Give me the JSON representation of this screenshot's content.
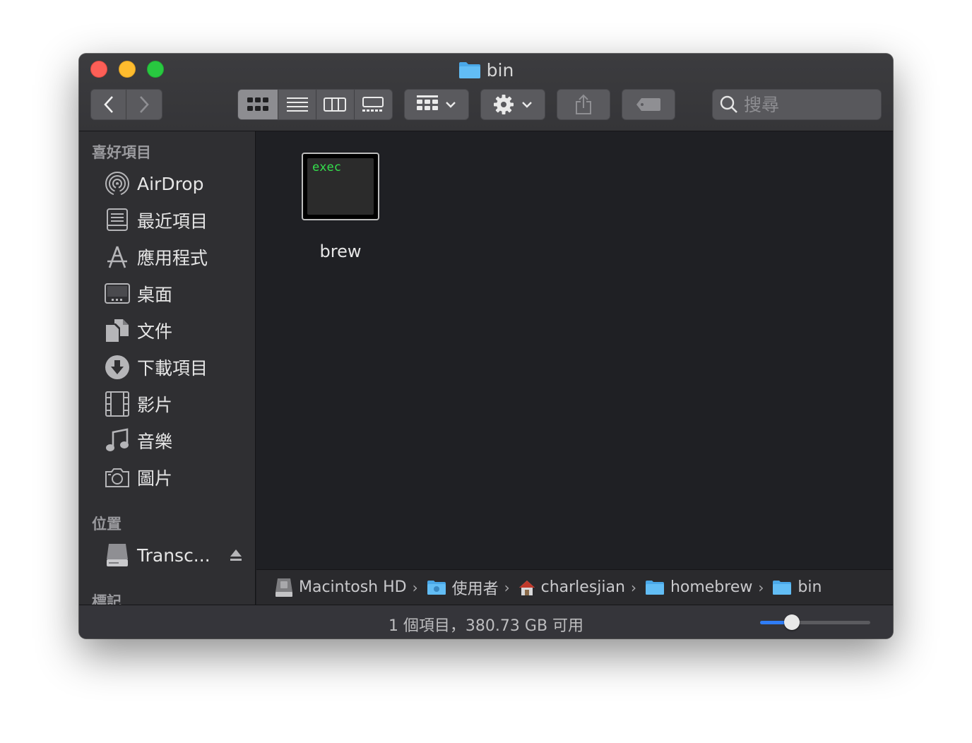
{
  "window": {
    "title": "bin"
  },
  "toolbar": {
    "back": "back",
    "forward": "forward",
    "view_modes": [
      "icon-view",
      "list-view",
      "column-view",
      "gallery-view"
    ],
    "group_by": "group-by",
    "action": "action",
    "share": "share",
    "tags": "tags"
  },
  "search": {
    "placeholder": "搜尋"
  },
  "sidebar": {
    "favorites_heading": "喜好項目",
    "favorites": [
      {
        "label": "AirDrop",
        "icon": "airdrop-icon"
      },
      {
        "label": "最近項目",
        "icon": "recents-icon"
      },
      {
        "label": "應用程式",
        "icon": "applications-icon"
      },
      {
        "label": "桌面",
        "icon": "desktop-icon"
      },
      {
        "label": "文件",
        "icon": "documents-icon"
      },
      {
        "label": "下載項目",
        "icon": "downloads-icon"
      },
      {
        "label": "影片",
        "icon": "movies-icon"
      },
      {
        "label": "音樂",
        "icon": "music-icon"
      },
      {
        "label": "圖片",
        "icon": "pictures-icon"
      }
    ],
    "locations_heading": "位置",
    "locations": [
      {
        "label": "Transc...",
        "icon": "drive-icon"
      }
    ],
    "tags_heading": "標記"
  },
  "files": [
    {
      "name": "brew",
      "icon_text": "exec"
    }
  ],
  "path": [
    {
      "label": "Macintosh HD",
      "icon": "hard-drive-icon"
    },
    {
      "label": "使用者",
      "icon": "users-folder-icon"
    },
    {
      "label": "charlesjian",
      "icon": "home-icon"
    },
    {
      "label": "homebrew",
      "icon": "folder-icon"
    },
    {
      "label": "bin",
      "icon": "folder-icon"
    }
  ],
  "status": {
    "text": "1 個項目，380.73 GB 可用",
    "icon_size_level": 0.25
  },
  "colors": {
    "accent": "#2f7df6",
    "exec_text": "#34e04c",
    "folder": "#4aa8e8"
  }
}
